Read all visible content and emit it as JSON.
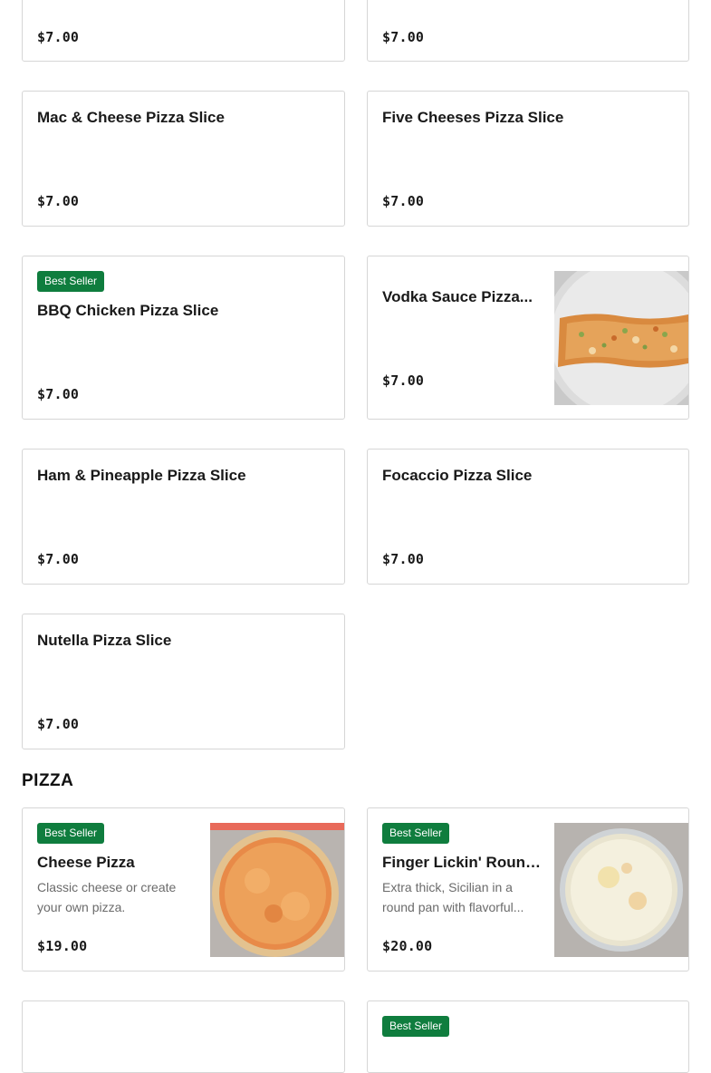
{
  "items": {
    "top_left": {
      "price": "$7.00"
    },
    "top_right": {
      "price": "$7.00"
    },
    "mac_cheese": {
      "name": "Mac & Cheese Pizza Slice",
      "price": "$7.00"
    },
    "five_cheeses": {
      "name": "Five Cheeses Pizza Slice",
      "price": "$7.00"
    },
    "bbq_chicken": {
      "badge": "Best Seller",
      "name": "BBQ Chicken Pizza Slice",
      "price": "$7.00"
    },
    "vodka_sauce": {
      "name": "Vodka Sauce Pizza...",
      "price": "$7.00",
      "image_icon": "pizza-slice-photo"
    },
    "ham_pineapple": {
      "name": "Ham & Pineapple Pizza Slice",
      "price": "$7.00"
    },
    "focaccio": {
      "name": "Focaccio Pizza Slice",
      "price": "$7.00"
    },
    "nutella": {
      "name": "Nutella Pizza Slice",
      "price": "$7.00"
    }
  },
  "pizza_section": {
    "title": "PIZZA",
    "items": {
      "cheese_pizza": {
        "badge": "Best Seller",
        "name": "Cheese Pizza",
        "desc_line1": "Classic cheese or create",
        "desc_line2": "your own pizza.",
        "price": "$19.00",
        "image_icon": "cheese-pizza-photo"
      },
      "finger_lickin": {
        "badge": "Best Seller",
        "name": "Finger Lickin' Round...",
        "desc_line1": "Extra thick, Sicilian in a",
        "desc_line2": "round pan with flavorful...",
        "price": "$20.00",
        "image_icon": "round-pizza-photo"
      },
      "bottom_right": {
        "badge": "Best Seller"
      }
    }
  },
  "colors": {
    "badge": "#0f7d3e",
    "border": "#d6d6d6",
    "text": "#191919",
    "muted": "#6b6b6b"
  }
}
